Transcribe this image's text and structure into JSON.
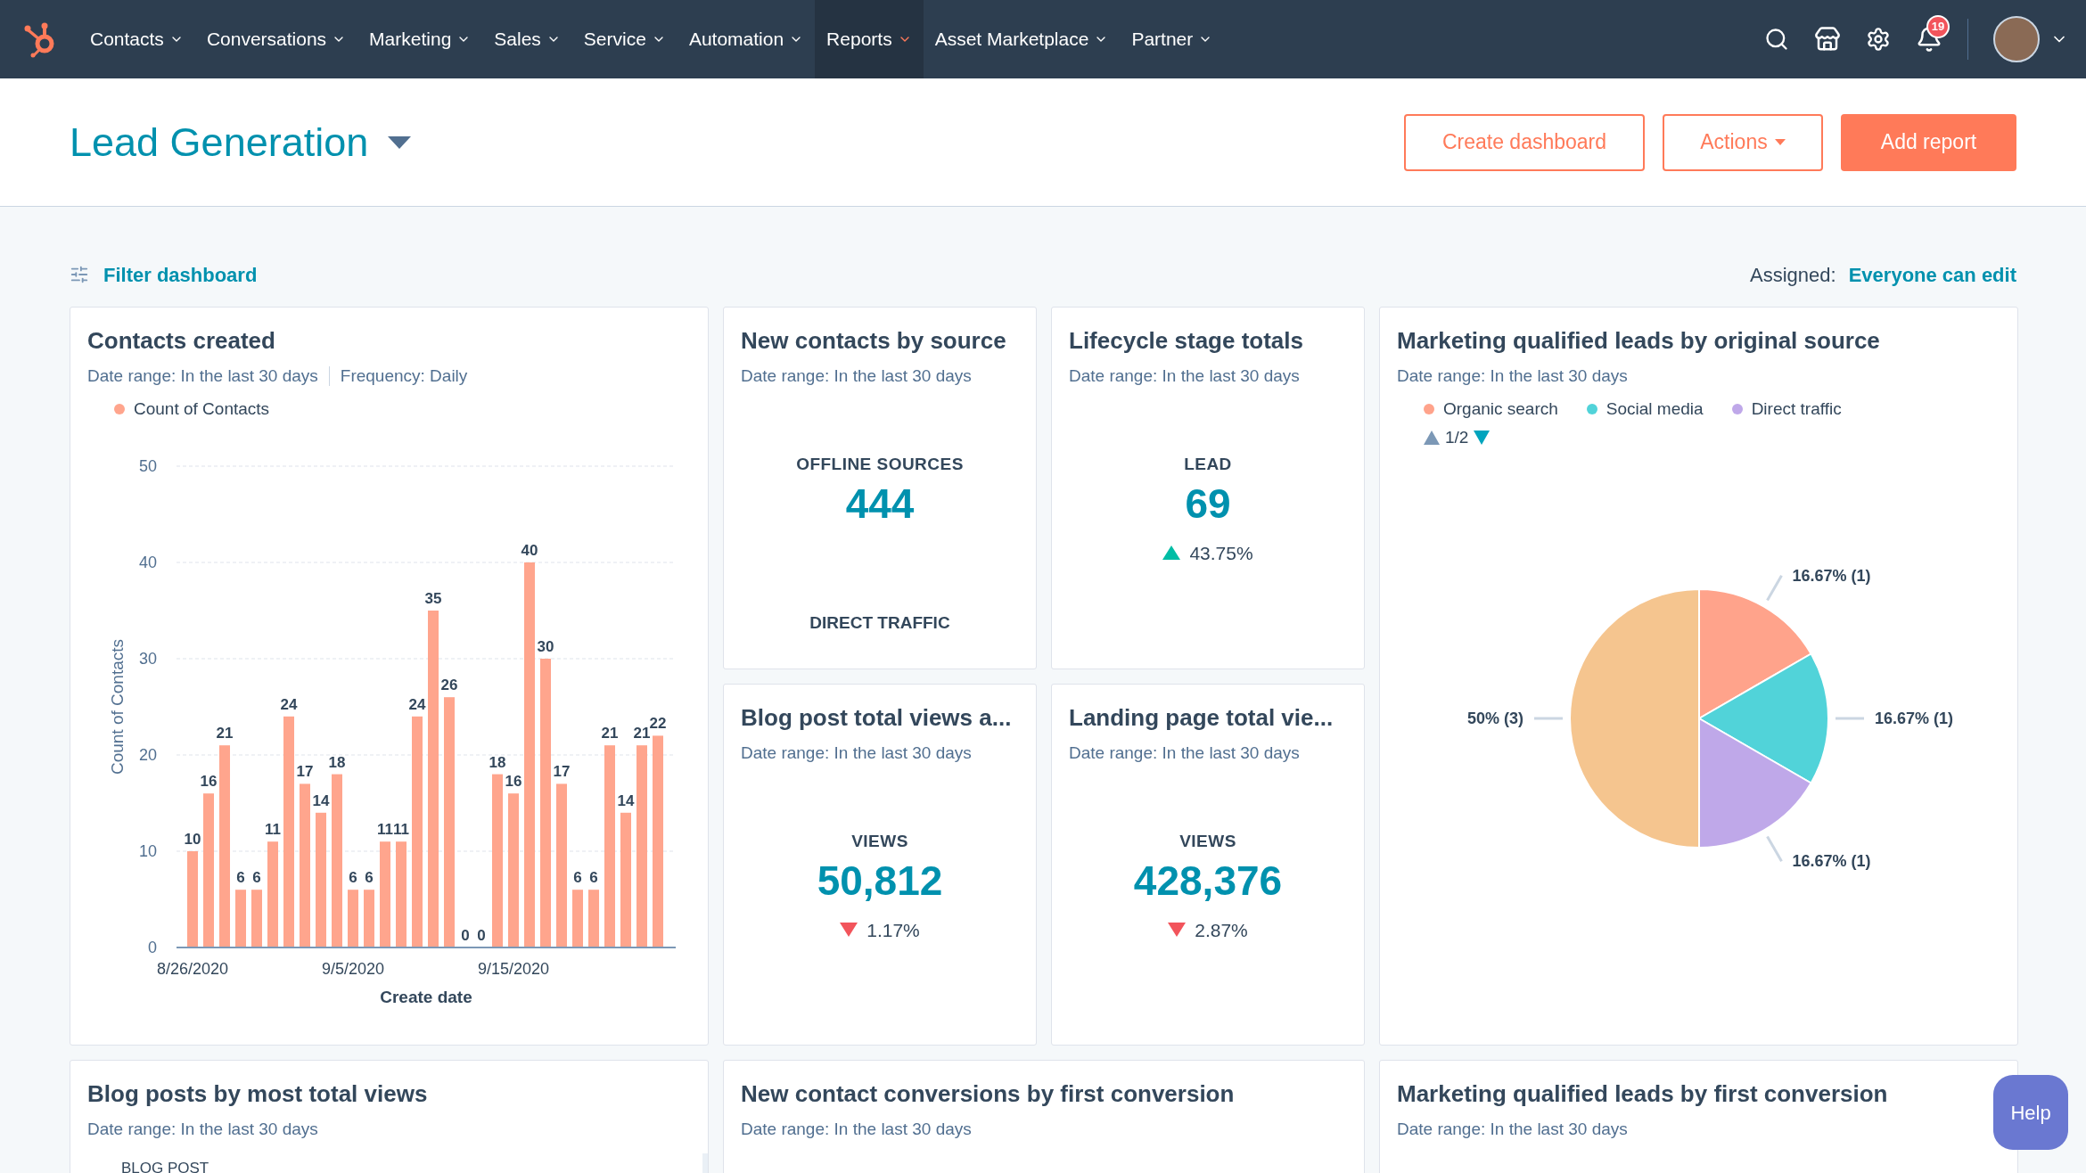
{
  "nav": {
    "items": [
      {
        "label": "Contacts",
        "selected": false
      },
      {
        "label": "Conversations",
        "selected": false
      },
      {
        "label": "Marketing",
        "selected": false
      },
      {
        "label": "Sales",
        "selected": false
      },
      {
        "label": "Service",
        "selected": false
      },
      {
        "label": "Automation",
        "selected": false
      },
      {
        "label": "Reports",
        "selected": true
      },
      {
        "label": "Asset Marketplace",
        "selected": false
      },
      {
        "label": "Partner",
        "selected": false
      }
    ],
    "notification_count": "19"
  },
  "header": {
    "title": "Lead Generation",
    "buttons": [
      {
        "label": "Create dashboard",
        "kind": "outline"
      },
      {
        "label": "Actions",
        "kind": "dropdown"
      },
      {
        "label": "Add report",
        "kind": "primary"
      }
    ]
  },
  "toolbar": {
    "filter": "Filter dashboard",
    "assigned_label": "Assigned:",
    "assigned_value": "Everyone can edit"
  },
  "cards": [
    {
      "kind": "bar",
      "title": "Contacts created",
      "meta": [
        "Date range: In the last 30 days",
        "Frequency: Daily"
      ],
      "chart_data": {
        "type": "bar",
        "xlabel": "Create date",
        "ylabel": "Count of Contacts",
        "ylim": [
          0,
          50
        ],
        "yticks": [
          0,
          10,
          20,
          30,
          40,
          50
        ],
        "grid": true,
        "categories": [
          "8/26/2020",
          null,
          null,
          null,
          null,
          null,
          null,
          null,
          null,
          null,
          "9/5/2020",
          null,
          null,
          null,
          null,
          null,
          null,
          null,
          null,
          null,
          "9/15/2020",
          null,
          null,
          null,
          null,
          null,
          null,
          null,
          null,
          null
        ],
        "data_labels": true,
        "series": [
          {
            "name": "Count of Contacts",
            "color": "#ffa58d",
            "values": [
              10,
              16,
              21,
              6,
              6,
              11,
              24,
              17,
              14,
              18,
              6,
              6,
              11,
              11,
              24,
              35,
              26,
              0,
              0,
              18,
              16,
              40,
              30,
              17,
              6,
              6,
              21,
              14,
              21,
              22
            ]
          }
        ]
      }
    },
    {
      "kind": "kpi",
      "title": "New contacts by source",
      "meta": [
        "Date range: In the last 30 days"
      ],
      "label": "OFFLINE SOURCES",
      "value": "444",
      "footer": "DIRECT TRAFFIC"
    },
    {
      "kind": "kpi",
      "title": "Lifecycle stage totals",
      "meta": [
        "Date range: In the last 30 days"
      ],
      "label": "LEAD",
      "value": "69",
      "change": {
        "kind": "up",
        "text": "43.75%"
      }
    },
    {
      "kind": "pie",
      "title": "Marketing qualified leads by original source",
      "meta": [
        "Date range: In the last 30 days"
      ],
      "pager": "1/2",
      "chart_data": {
        "type": "pie",
        "categories": [
          "Organic search",
          "Social media",
          "Direct traffic",
          null
        ],
        "values": [
          1,
          1,
          1,
          3
        ],
        "colors": [
          "#ffa38b",
          "#51d3d9",
          "#bfa8e9",
          "#f5c58f"
        ],
        "value_labels": [
          "16.67% (1)",
          "16.67% (1)",
          "16.67% (1)",
          "50% (3)"
        ]
      }
    },
    {
      "kind": "kpi",
      "title": "Blog post total views a...",
      "meta": [
        "Date range: In the last 30 days"
      ],
      "label": "VIEWS",
      "value": "50,812",
      "change": {
        "kind": "down",
        "text": "1.17%"
      }
    },
    {
      "kind": "kpi",
      "title": "Landing page total vie...",
      "meta": [
        "Date range: In the last 30 days"
      ],
      "label": "VIEWS",
      "value": "428,376",
      "change": {
        "kind": "down",
        "text": "2.87%"
      }
    },
    {
      "kind": "table",
      "title": "Blog posts by most total views",
      "meta": [
        "Date range: In the last 30 days"
      ],
      "column": "BLOG POST"
    },
    {
      "kind": "plain",
      "title": "New contact conversions by first conversion",
      "meta": [
        "Date range: In the last 30 days"
      ]
    },
    {
      "kind": "plain",
      "title": "Marketing qualified leads by first conversion",
      "meta": [
        "Date range: In the last 30 days"
      ]
    }
  ],
  "help": "Help"
}
